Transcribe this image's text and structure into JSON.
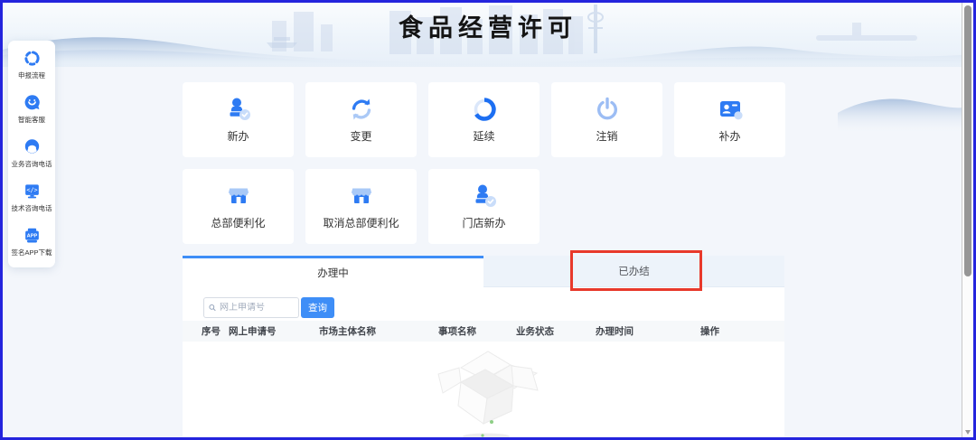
{
  "header": {
    "title": "食品经营许可"
  },
  "sidebar": {
    "items": [
      {
        "label": "申报流程",
        "icon": "flow-icon"
      },
      {
        "label": "智能客服",
        "icon": "chat-smile-icon"
      },
      {
        "label": "业务咨询电话",
        "icon": "headset-icon"
      },
      {
        "label": "技术咨询电话",
        "icon": "code-monitor-icon",
        "icon_text": "</>"
      },
      {
        "label": "签名APP下载",
        "icon": "app-download-icon",
        "icon_text": "APP"
      }
    ]
  },
  "actions": {
    "row1": [
      {
        "label": "新办",
        "icon": "stamp-check-icon"
      },
      {
        "label": "变更",
        "icon": "refresh-icon"
      },
      {
        "label": "延续",
        "icon": "progress-circle-icon"
      },
      {
        "label": "注销",
        "icon": "power-icon"
      },
      {
        "label": "补办",
        "icon": "id-card-icon"
      }
    ],
    "row2": [
      {
        "label": "总部便利化",
        "icon": "storefront-icon"
      },
      {
        "label": "取消总部便利化",
        "icon": "storefront-icon"
      },
      {
        "label": "门店新办",
        "icon": "stamp-check-icon"
      }
    ]
  },
  "tabs": [
    {
      "label": "办理中",
      "state": "active"
    },
    {
      "label": "已办结",
      "state": "inactive",
      "annotation": "red-highlight-box"
    }
  ],
  "search": {
    "placeholder": "网上申请号",
    "button_label": "查询",
    "icon": "search-icon"
  },
  "table": {
    "columns": [
      "序号",
      "网上申请号",
      "市场主体名称",
      "事项名称",
      "业务状态",
      "办理时间",
      "操作"
    ],
    "rows": [],
    "empty_state_icon": "empty-open-box-illustration"
  },
  "colors": {
    "accent_blue": "#3e8ef7",
    "icon_blue": "#2e7bf3",
    "icon_light_blue": "#a9c9f7",
    "annotation_red": "#e8392b",
    "frame_blue": "#2424dd",
    "page_background": "#f3f6fb",
    "inactive_tab_background": "#edf3fa"
  }
}
